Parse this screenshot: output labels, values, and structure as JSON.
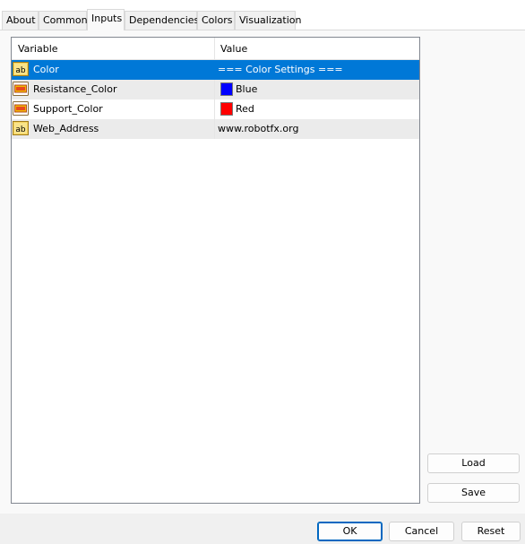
{
  "tabs": [
    "About",
    "Common",
    "Inputs",
    "Dependencies",
    "Colors",
    "Visualization"
  ],
  "active_tab": "Inputs",
  "table": {
    "columns": [
      "Variable",
      "Value"
    ],
    "rows": [
      {
        "variable": "Color",
        "value": "=== Color Settings ===",
        "icon": "string-ab-icon",
        "selected": true
      },
      {
        "variable": "Resistance_Color",
        "value": "Blue",
        "icon": "color-param-icon",
        "swatch": "#0000ff"
      },
      {
        "variable": "Support_Color",
        "value": "Red",
        "icon": "color-param-icon",
        "swatch": "#ff0000"
      },
      {
        "variable": "Web_Address",
        "value": "www.robotfx.org",
        "icon": "string-ab-icon"
      }
    ]
  },
  "side_buttons": {
    "load": "Load",
    "save": "Save"
  },
  "dialog_buttons": {
    "ok": "OK",
    "cancel": "Cancel",
    "reset": "Reset"
  },
  "colors": {
    "selection": "#0078d7",
    "alt_row": "#ebebeb"
  }
}
